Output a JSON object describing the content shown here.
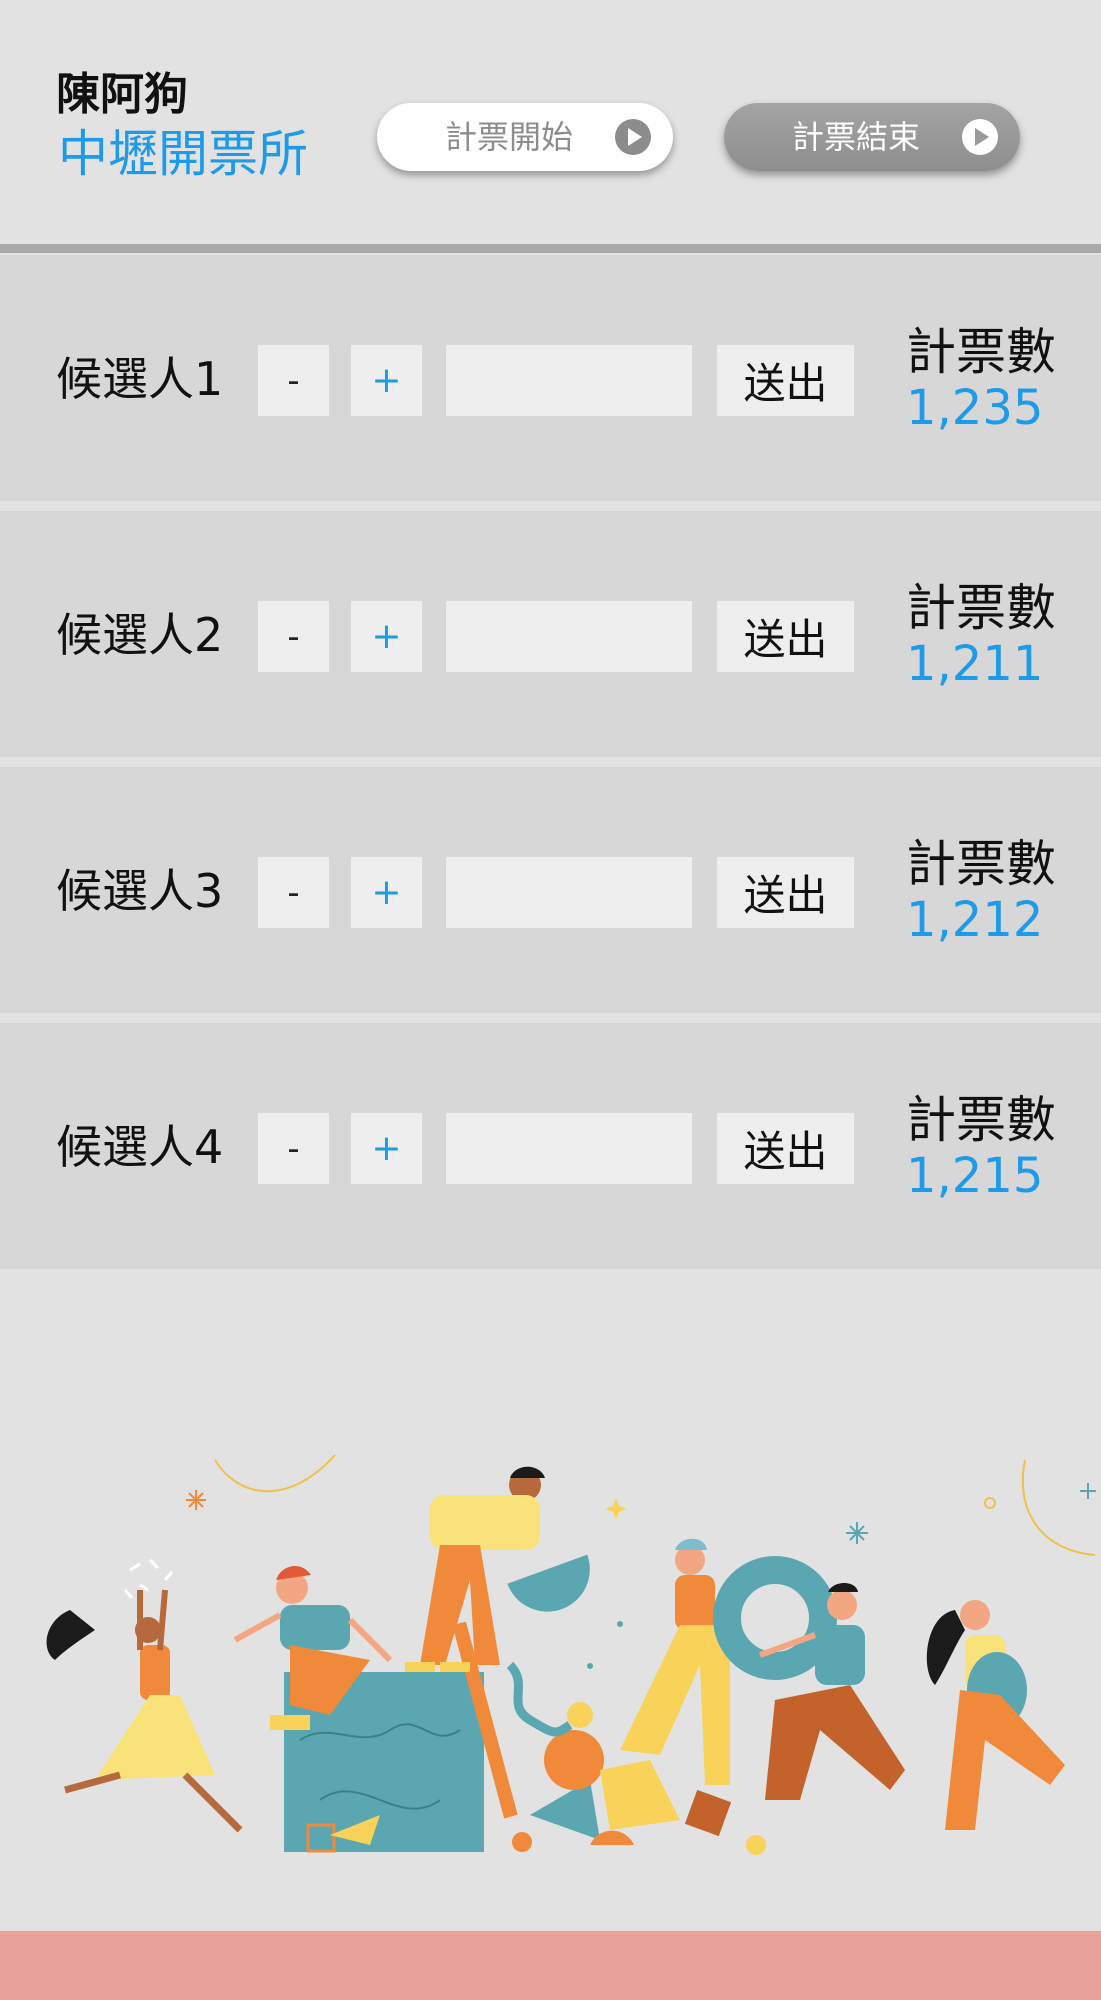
{
  "header": {
    "user_name": "陳阿狗",
    "station_name": "中壢開票所",
    "start_button": {
      "label": "計票開始",
      "icon": "play-circle-icon"
    },
    "end_button": {
      "label": "計票結束",
      "icon": "play-circle-icon"
    }
  },
  "candidates": [
    {
      "name": "候選人1",
      "minus_label": "-",
      "plus_label": "+",
      "input_value": "",
      "submit_label": "送出",
      "tally_label": "計票數",
      "tally_value": "1,235"
    },
    {
      "name": "候選人2",
      "minus_label": "-",
      "plus_label": "+",
      "input_value": "",
      "submit_label": "送出",
      "tally_label": "計票數",
      "tally_value": "1,211"
    },
    {
      "name": "候選人3",
      "minus_label": "-",
      "plus_label": "+",
      "input_value": "",
      "submit_label": "送出",
      "tally_label": "計票數",
      "tally_value": "1,212"
    },
    {
      "name": "候選人4",
      "minus_label": "-",
      "plus_label": "+",
      "input_value": "",
      "submit_label": "送出",
      "tally_label": "計票數",
      "tally_value": "1,215"
    }
  ],
  "colors": {
    "accent": "#1e9be8",
    "background": "#e2e2e2",
    "row_background": "#d7d7d7",
    "control_background": "#eeeeee",
    "footer": "#e8a19b",
    "illustration_teal": "#5ba7b1",
    "illustration_orange": "#f08a3a",
    "illustration_yellow": "#f9d25a"
  },
  "illustration": {
    "icon": "people-celebrating-illustration"
  }
}
